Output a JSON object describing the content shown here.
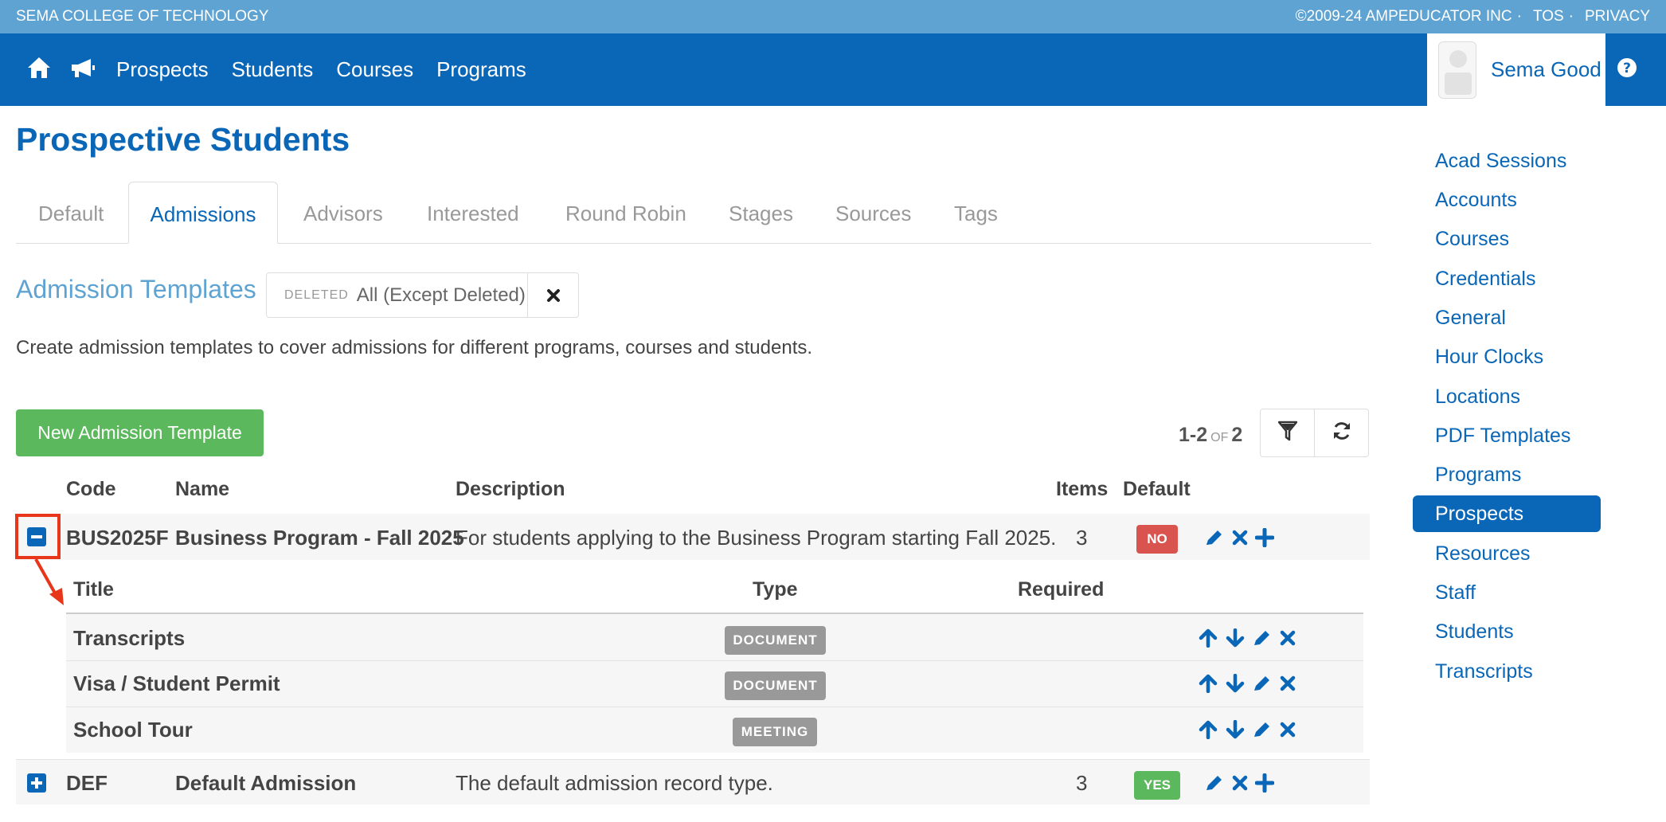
{
  "topbar": {
    "org": "SEMA COLLEGE OF TECHNOLOGY",
    "copyright": "©2009-24 AMPEDUCATOR INC",
    "tos": "TOS",
    "privacy": "PRIVACY",
    "separator": "·"
  },
  "nav": {
    "items": [
      {
        "label": "Prospects"
      },
      {
        "label": "Students"
      },
      {
        "label": "Courses"
      },
      {
        "label": "Programs"
      }
    ],
    "user_name": "Sema Good"
  },
  "page": {
    "title": "Prospective Students"
  },
  "tabs": [
    {
      "label": "Default",
      "active": false
    },
    {
      "label": "Admissions",
      "active": true
    },
    {
      "label": "Advisors",
      "active": false
    },
    {
      "label": "Interested",
      "active": false
    },
    {
      "label": "Round Robin",
      "active": false
    },
    {
      "label": "Stages",
      "active": false
    },
    {
      "label": "Sources",
      "active": false
    },
    {
      "label": "Tags",
      "active": false
    }
  ],
  "section": {
    "title": "Admission Templates",
    "filter_label": "DELETED",
    "filter_value": "All (Except Deleted)",
    "description": "Create admission templates to cover admissions for different programs, courses and students.",
    "new_button": "New Admission Template",
    "pager": {
      "range": "1-2",
      "of": "OF",
      "total": "2"
    }
  },
  "table": {
    "headers": {
      "code": "Code",
      "name": "Name",
      "description": "Description",
      "items": "Items",
      "default": "Default"
    },
    "rows": [
      {
        "code": "BUS2025F",
        "name": "Business Program - Fall 2025",
        "description": "For students applying to the Business Program starting Fall 2025.",
        "items": "3",
        "default": "NO"
      },
      {
        "code": "DEF",
        "name": "Default Admission",
        "description": "The default admission record type.",
        "items": "3",
        "default": "YES"
      }
    ],
    "sub_headers": {
      "title": "Title",
      "type": "Type",
      "required": "Required"
    },
    "sub_rows": [
      {
        "title": "Transcripts",
        "type": "DOCUMENT"
      },
      {
        "title": "Visa / Student Permit",
        "type": "DOCUMENT"
      },
      {
        "title": "School Tour",
        "type": "MEETING"
      }
    ]
  },
  "sidebar": {
    "items": [
      {
        "label": "Acad Sessions"
      },
      {
        "label": "Accounts"
      },
      {
        "label": "Courses"
      },
      {
        "label": "Credentials"
      },
      {
        "label": "General"
      },
      {
        "label": "Hour Clocks"
      },
      {
        "label": "Locations"
      },
      {
        "label": "PDF Templates"
      },
      {
        "label": "Programs"
      },
      {
        "label": "Prospects",
        "active": true
      },
      {
        "label": "Resources"
      },
      {
        "label": "Staff"
      },
      {
        "label": "Students"
      },
      {
        "label": "Transcripts"
      }
    ]
  },
  "colors": {
    "topbar": "#5fa3d3",
    "navbar": "#0a66b6",
    "accent": "#0a66b6",
    "success": "#5cb85c",
    "danger": "#d9534f",
    "highlight": "#e8361b"
  },
  "icons": [
    "home-icon",
    "megaphone-icon",
    "help-icon",
    "close-icon",
    "filter-icon",
    "refresh-icon",
    "collapse-icon",
    "expand-icon",
    "edit-icon",
    "delete-icon",
    "add-icon",
    "arrow-up-icon",
    "arrow-down-icon"
  ]
}
